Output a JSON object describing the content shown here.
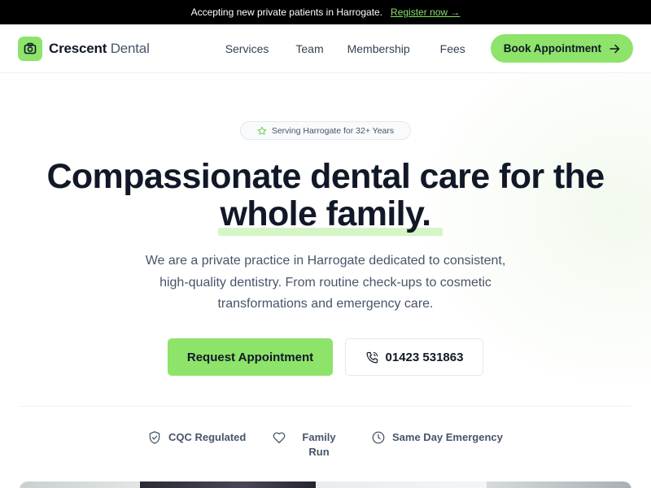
{
  "announcement": {
    "text": "Accepting new private patients in Harrogate.",
    "link_label": "Register now →"
  },
  "brand": {
    "name_bold": "Crescent",
    "name_light": "Dental",
    "logo_icon": "tooth-camera-icon"
  },
  "nav": {
    "items": [
      {
        "label": "Services"
      },
      {
        "label": "Team"
      },
      {
        "label": "Membership"
      },
      {
        "label": "Fees"
      }
    ],
    "book_label": "Book Appointment"
  },
  "hero": {
    "badge": "Serving Harrogate for 32+ Years",
    "headline_line1": "Compassionate dental care for the",
    "headline_line2": "whole family.",
    "subtext_line1": "We are a private practice in Harrogate dedicated to consistent,",
    "subtext_line2": "high-quality dentistry. From routine check-ups to cosmetic",
    "subtext_line3": "transformations and emergency care.",
    "cta_primary": "Request Appointment",
    "cta_phone": "01423 531863"
  },
  "features": [
    {
      "label": "CQC Regulated",
      "icon": "shield-check-icon"
    },
    {
      "label": "Family Run",
      "icon": "heart-icon"
    },
    {
      "label": "Same Day Emergency",
      "icon": "clock-icon"
    }
  ],
  "colors": {
    "accent": "#8ee36a",
    "dark": "#111827",
    "announcement_bg": "#000000"
  }
}
